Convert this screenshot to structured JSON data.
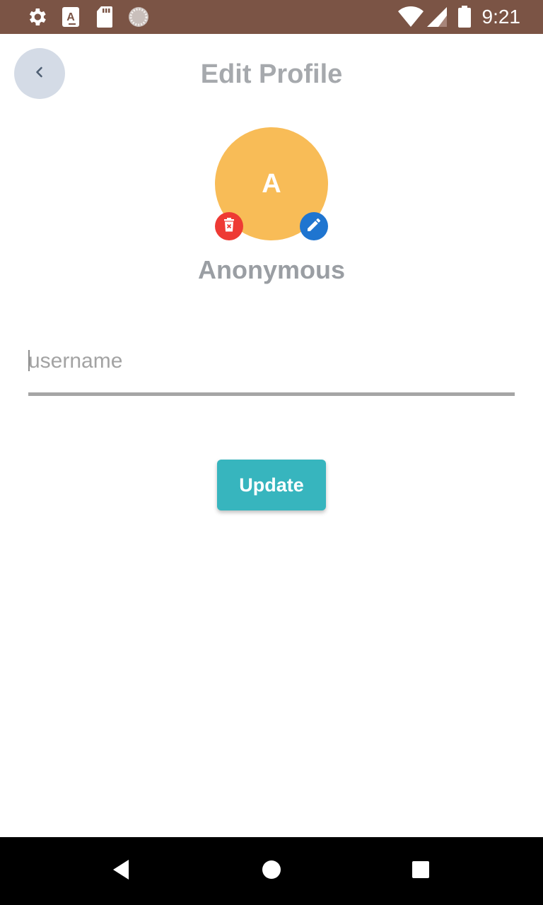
{
  "status_bar": {
    "time": "9:21",
    "icons": [
      "gear-icon",
      "text-a-icon",
      "sd-card-icon",
      "spinner-icon",
      "wifi-icon",
      "cell-signal-icon",
      "battery-icon"
    ],
    "background": "#7b5445"
  },
  "header": {
    "title": "Edit Profile",
    "back_icon": "chevron-left-icon"
  },
  "profile": {
    "avatar_letter": "A",
    "avatar_color": "#f8bc57",
    "name": "Anonymous",
    "delete_icon": "trash-icon",
    "edit_icon": "pencil-icon"
  },
  "form": {
    "username_placeholder": "username",
    "username_value": "",
    "update_label": "Update",
    "accent": "#37b5be"
  },
  "nav_bar": {
    "items": [
      "back-triangle-icon",
      "home-circle-icon",
      "recents-square-icon"
    ]
  }
}
